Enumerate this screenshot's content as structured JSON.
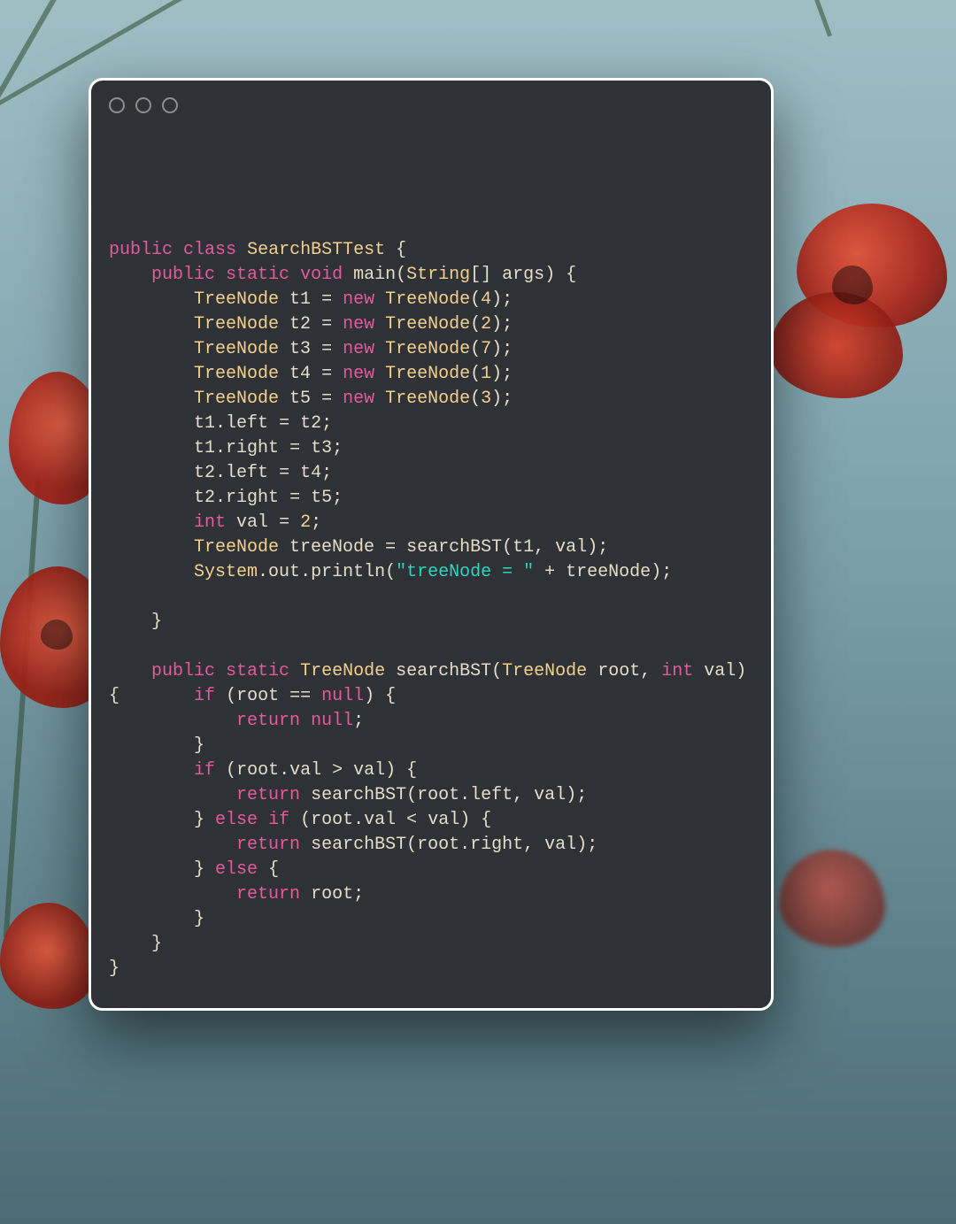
{
  "background": {
    "top_color": "#9fbec4",
    "bottom_color": "#4a6b74",
    "accent_red": "#c0382b"
  },
  "window": {
    "bg_color": "#2e3136",
    "border_color": "#ffffff",
    "traffic_light_count": 3
  },
  "syntax_colors": {
    "keyword": "#e65a9c",
    "type": "#f2d190",
    "identifier": "#e6ddc9",
    "number": "#f2d190",
    "string": "#2fd4bf",
    "null": "#e65a9c"
  },
  "code": {
    "language": "Java",
    "lines": [
      [
        [
          "blank",
          ""
        ]
      ],
      [
        [
          "keyword",
          "public"
        ],
        [
          "sp",
          " "
        ],
        [
          "keyword",
          "class"
        ],
        [
          "sp",
          " "
        ],
        [
          "type",
          "SearchBSTTest"
        ],
        [
          "sp",
          " "
        ],
        [
          "punct",
          "{"
        ]
      ],
      [
        [
          "indent",
          "    "
        ],
        [
          "keyword",
          "public"
        ],
        [
          "sp",
          " "
        ],
        [
          "keyword",
          "static"
        ],
        [
          "sp",
          " "
        ],
        [
          "keyword",
          "void"
        ],
        [
          "sp",
          " "
        ],
        [
          "method",
          "main"
        ],
        [
          "punct",
          "("
        ],
        [
          "type",
          "String"
        ],
        [
          "punct",
          "[] "
        ],
        [
          "ident",
          "args"
        ],
        [
          "punct",
          ") {"
        ]
      ],
      [
        [
          "indent",
          "        "
        ],
        [
          "type",
          "TreeNode"
        ],
        [
          "sp",
          " "
        ],
        [
          "ident",
          "t1"
        ],
        [
          "sp",
          " "
        ],
        [
          "punct",
          "= "
        ],
        [
          "keyword",
          "new"
        ],
        [
          "sp",
          " "
        ],
        [
          "type",
          "TreeNode"
        ],
        [
          "punct",
          "("
        ],
        [
          "number",
          "4"
        ],
        [
          "punct",
          ");"
        ]
      ],
      [
        [
          "indent",
          "        "
        ],
        [
          "type",
          "TreeNode"
        ],
        [
          "sp",
          " "
        ],
        [
          "ident",
          "t2"
        ],
        [
          "sp",
          " "
        ],
        [
          "punct",
          "= "
        ],
        [
          "keyword",
          "new"
        ],
        [
          "sp",
          " "
        ],
        [
          "type",
          "TreeNode"
        ],
        [
          "punct",
          "("
        ],
        [
          "number",
          "2"
        ],
        [
          "punct",
          ");"
        ]
      ],
      [
        [
          "indent",
          "        "
        ],
        [
          "type",
          "TreeNode"
        ],
        [
          "sp",
          " "
        ],
        [
          "ident",
          "t3"
        ],
        [
          "sp",
          " "
        ],
        [
          "punct",
          "= "
        ],
        [
          "keyword",
          "new"
        ],
        [
          "sp",
          " "
        ],
        [
          "type",
          "TreeNode"
        ],
        [
          "punct",
          "("
        ],
        [
          "number",
          "7"
        ],
        [
          "punct",
          ");"
        ]
      ],
      [
        [
          "indent",
          "        "
        ],
        [
          "type",
          "TreeNode"
        ],
        [
          "sp",
          " "
        ],
        [
          "ident",
          "t4"
        ],
        [
          "sp",
          " "
        ],
        [
          "punct",
          "= "
        ],
        [
          "keyword",
          "new"
        ],
        [
          "sp",
          " "
        ],
        [
          "type",
          "TreeNode"
        ],
        [
          "punct",
          "("
        ],
        [
          "number",
          "1"
        ],
        [
          "punct",
          ");"
        ]
      ],
      [
        [
          "indent",
          "        "
        ],
        [
          "type",
          "TreeNode"
        ],
        [
          "sp",
          " "
        ],
        [
          "ident",
          "t5"
        ],
        [
          "sp",
          " "
        ],
        [
          "punct",
          "= "
        ],
        [
          "keyword",
          "new"
        ],
        [
          "sp",
          " "
        ],
        [
          "type",
          "TreeNode"
        ],
        [
          "punct",
          "("
        ],
        [
          "number",
          "3"
        ],
        [
          "punct",
          ");"
        ]
      ],
      [
        [
          "indent",
          "        "
        ],
        [
          "ident",
          "t1"
        ],
        [
          "punct",
          "."
        ],
        [
          "ident",
          "left"
        ],
        [
          "sp",
          " "
        ],
        [
          "punct",
          "= "
        ],
        [
          "ident",
          "t2"
        ],
        [
          "punct",
          ";"
        ]
      ],
      [
        [
          "indent",
          "        "
        ],
        [
          "ident",
          "t1"
        ],
        [
          "punct",
          "."
        ],
        [
          "ident",
          "right"
        ],
        [
          "sp",
          " "
        ],
        [
          "punct",
          "= "
        ],
        [
          "ident",
          "t3"
        ],
        [
          "punct",
          ";"
        ]
      ],
      [
        [
          "indent",
          "        "
        ],
        [
          "ident",
          "t2"
        ],
        [
          "punct",
          "."
        ],
        [
          "ident",
          "left"
        ],
        [
          "sp",
          " "
        ],
        [
          "punct",
          "= "
        ],
        [
          "ident",
          "t4"
        ],
        [
          "punct",
          ";"
        ]
      ],
      [
        [
          "indent",
          "        "
        ],
        [
          "ident",
          "t2"
        ],
        [
          "punct",
          "."
        ],
        [
          "ident",
          "right"
        ],
        [
          "sp",
          " "
        ],
        [
          "punct",
          "= "
        ],
        [
          "ident",
          "t5"
        ],
        [
          "punct",
          ";"
        ]
      ],
      [
        [
          "indent",
          "        "
        ],
        [
          "keyword",
          "int"
        ],
        [
          "sp",
          " "
        ],
        [
          "ident",
          "val"
        ],
        [
          "sp",
          " "
        ],
        [
          "punct",
          "= "
        ],
        [
          "number",
          "2"
        ],
        [
          "punct",
          ";"
        ]
      ],
      [
        [
          "indent",
          "        "
        ],
        [
          "type",
          "TreeNode"
        ],
        [
          "sp",
          " "
        ],
        [
          "ident",
          "treeNode"
        ],
        [
          "sp",
          " "
        ],
        [
          "punct",
          "= "
        ],
        [
          "method",
          "searchBST"
        ],
        [
          "punct",
          "("
        ],
        [
          "ident",
          "t1"
        ],
        [
          "punct",
          ", "
        ],
        [
          "ident",
          "val"
        ],
        [
          "punct",
          ");"
        ]
      ],
      [
        [
          "indent",
          "        "
        ],
        [
          "type",
          "System"
        ],
        [
          "punct",
          "."
        ],
        [
          "ident",
          "out"
        ],
        [
          "punct",
          "."
        ],
        [
          "method",
          "println"
        ],
        [
          "punct",
          "("
        ],
        [
          "string",
          "\"treeNode = \""
        ],
        [
          "sp",
          " "
        ],
        [
          "punct",
          "+ "
        ],
        [
          "ident",
          "treeNode"
        ],
        [
          "punct",
          ");"
        ]
      ],
      [
        [
          "blank",
          ""
        ]
      ],
      [
        [
          "indent",
          "    "
        ],
        [
          "punct",
          "}"
        ]
      ],
      [
        [
          "blank",
          ""
        ]
      ],
      [
        [
          "indent",
          "    "
        ],
        [
          "keyword",
          "public"
        ],
        [
          "sp",
          " "
        ],
        [
          "keyword",
          "static"
        ],
        [
          "sp",
          " "
        ],
        [
          "type",
          "TreeNode"
        ],
        [
          "sp",
          " "
        ],
        [
          "method",
          "searchBST"
        ],
        [
          "punct",
          "("
        ],
        [
          "type",
          "TreeNode"
        ],
        [
          "sp",
          " "
        ],
        [
          "ident",
          "root"
        ],
        [
          "punct",
          ", "
        ],
        [
          "keyword",
          "int"
        ],
        [
          "sp",
          " "
        ],
        [
          "ident",
          "val"
        ],
        [
          "punct",
          ") "
        ]
      ],
      [
        [
          "punct",
          "{"
        ],
        [
          "indent",
          "       "
        ],
        [
          "keyword",
          "if"
        ],
        [
          "sp",
          " "
        ],
        [
          "punct",
          "("
        ],
        [
          "ident",
          "root"
        ],
        [
          "sp",
          " "
        ],
        [
          "punct",
          "== "
        ],
        [
          "null",
          "null"
        ],
        [
          "punct",
          ") {"
        ]
      ],
      [
        [
          "indent",
          "            "
        ],
        [
          "keyword",
          "return"
        ],
        [
          "sp",
          " "
        ],
        [
          "null",
          "null"
        ],
        [
          "punct",
          ";"
        ]
      ],
      [
        [
          "indent",
          "        "
        ],
        [
          "punct",
          "}"
        ]
      ],
      [
        [
          "indent",
          "        "
        ],
        [
          "keyword",
          "if"
        ],
        [
          "sp",
          " "
        ],
        [
          "punct",
          "("
        ],
        [
          "ident",
          "root"
        ],
        [
          "punct",
          "."
        ],
        [
          "ident",
          "val"
        ],
        [
          "sp",
          " "
        ],
        [
          "punct",
          "> "
        ],
        [
          "ident",
          "val"
        ],
        [
          "punct",
          ") {"
        ]
      ],
      [
        [
          "indent",
          "            "
        ],
        [
          "keyword",
          "return"
        ],
        [
          "sp",
          " "
        ],
        [
          "method",
          "searchBST"
        ],
        [
          "punct",
          "("
        ],
        [
          "ident",
          "root"
        ],
        [
          "punct",
          "."
        ],
        [
          "ident",
          "left"
        ],
        [
          "punct",
          ", "
        ],
        [
          "ident",
          "val"
        ],
        [
          "punct",
          ");"
        ]
      ],
      [
        [
          "indent",
          "        "
        ],
        [
          "punct",
          "} "
        ],
        [
          "keyword",
          "else"
        ],
        [
          "sp",
          " "
        ],
        [
          "keyword",
          "if"
        ],
        [
          "sp",
          " "
        ],
        [
          "punct",
          "("
        ],
        [
          "ident",
          "root"
        ],
        [
          "punct",
          "."
        ],
        [
          "ident",
          "val"
        ],
        [
          "sp",
          " "
        ],
        [
          "punct",
          "< "
        ],
        [
          "ident",
          "val"
        ],
        [
          "punct",
          ") {"
        ]
      ],
      [
        [
          "indent",
          "            "
        ],
        [
          "keyword",
          "return"
        ],
        [
          "sp",
          " "
        ],
        [
          "method",
          "searchBST"
        ],
        [
          "punct",
          "("
        ],
        [
          "ident",
          "root"
        ],
        [
          "punct",
          "."
        ],
        [
          "ident",
          "right"
        ],
        [
          "punct",
          ", "
        ],
        [
          "ident",
          "val"
        ],
        [
          "punct",
          ");"
        ]
      ],
      [
        [
          "indent",
          "        "
        ],
        [
          "punct",
          "} "
        ],
        [
          "keyword",
          "else"
        ],
        [
          "sp",
          " "
        ],
        [
          "punct",
          "{"
        ]
      ],
      [
        [
          "indent",
          "            "
        ],
        [
          "keyword",
          "return"
        ],
        [
          "sp",
          " "
        ],
        [
          "ident",
          "root"
        ],
        [
          "punct",
          ";"
        ]
      ],
      [
        [
          "indent",
          "        "
        ],
        [
          "punct",
          "}"
        ]
      ],
      [
        [
          "indent",
          "    "
        ],
        [
          "punct",
          "}"
        ]
      ],
      [
        [
          "punct",
          "}"
        ]
      ]
    ]
  }
}
